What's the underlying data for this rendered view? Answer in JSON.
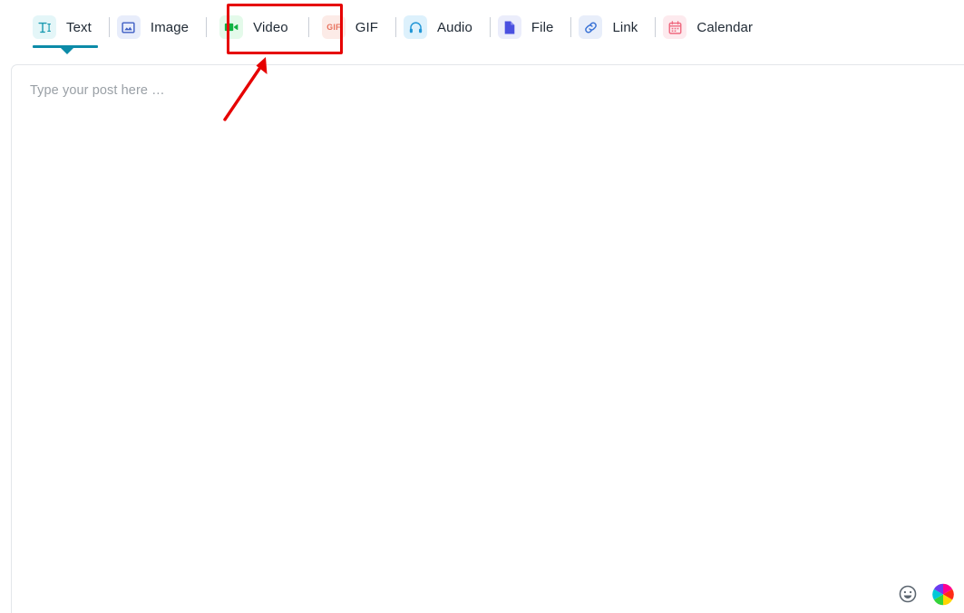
{
  "toolbar": {
    "tabs": [
      {
        "label": "Text",
        "icon": "text-format-icon",
        "icon_color": "#1a9ab0",
        "icon_bg": "#e4f6f8",
        "active": true
      },
      {
        "label": "Image",
        "icon": "image-icon",
        "icon_color": "#3f5fc4",
        "icon_bg": "#e8edfb",
        "active": false
      },
      {
        "label": "Video",
        "icon": "video-camera-icon",
        "icon_color": "#12b042",
        "icon_bg": "#e4faea",
        "active": false
      },
      {
        "label": "GIF",
        "icon": "gif-icon",
        "icon_color": "#e8715c",
        "icon_bg": "#fcebe7",
        "active": false
      },
      {
        "label": "Audio",
        "icon": "headphones-icon",
        "icon_color": "#2196d6",
        "icon_bg": "#ddf1fc",
        "active": false
      },
      {
        "label": "File",
        "icon": "file-document-icon",
        "icon_color": "#4a50e0",
        "icon_bg": "#ebedfb",
        "active": false
      },
      {
        "label": "Link",
        "icon": "chain-link-icon",
        "icon_color": "#3a73d6",
        "icon_bg": "#e8eefa",
        "active": false
      },
      {
        "label": "Calendar",
        "icon": "calendar-icon",
        "icon_color": "#ef6a80",
        "icon_bg": "#fdeaee",
        "active": false
      }
    ]
  },
  "editor": {
    "placeholder": "Type your post here …",
    "value": "",
    "tools": [
      {
        "name": "emoji-picker",
        "label": "emoji-smiley-icon"
      },
      {
        "name": "color-picker",
        "label": "color-wheel-icon"
      }
    ]
  },
  "annotation": {
    "highlight_target": "Video",
    "box_color": "#e60000",
    "arrow_color": "#e60000"
  },
  "colors": {
    "accent": "#0c8ba8",
    "text": "#212b36",
    "placeholder": "#9aa0a6",
    "border": "#e3e6ea",
    "divider": "#c9ced6"
  }
}
